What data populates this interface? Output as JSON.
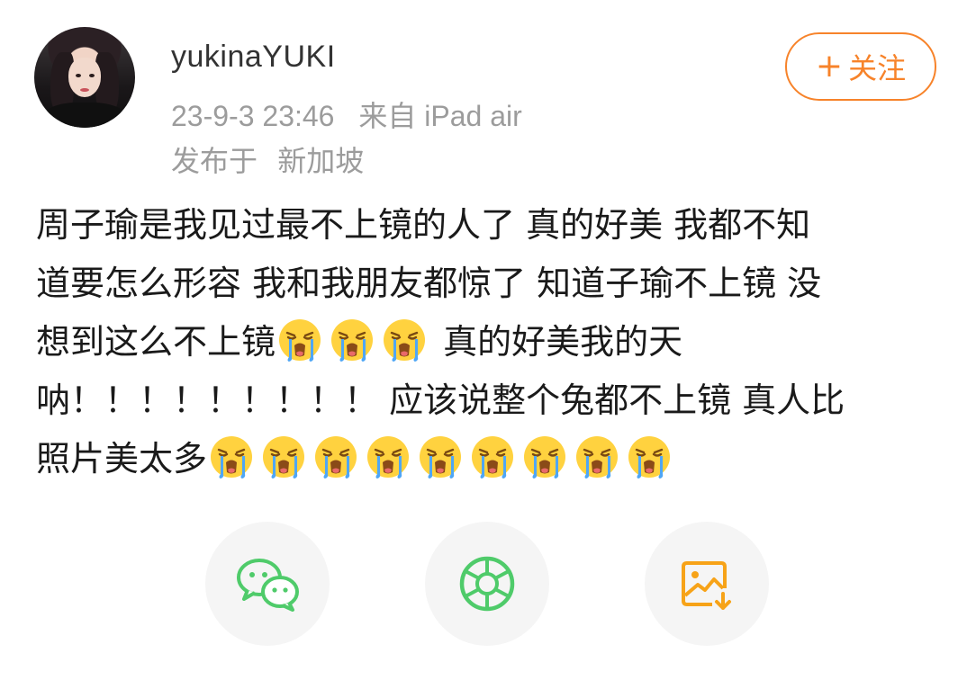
{
  "header": {
    "username": "yukinaYUKI",
    "timestamp": "23-9-3 23:46",
    "source": "来自 iPad air",
    "location_prefix": "发布于",
    "location": "新加坡",
    "follow_plus": "+",
    "follow_label": "关注"
  },
  "post": {
    "line1": "周子瑜是我见过最不上镜的人了 真的好美 我都不知",
    "line2": "道要怎么形容 我和我朋友都惊了 知道子瑜不上镜 没",
    "line3_a": "想到这么不上镜",
    "line3_b": "真的好美我的天",
    "line4": "呐！！！！！！！！！ 应该说整个兔都不上镜 真人比",
    "line5": "照片美太多",
    "emoji_name": "crying-emoji",
    "line3_emoji_count": 3,
    "line5_emoji_count": 9
  },
  "share": {
    "items": [
      {
        "icon": "wechat-icon"
      },
      {
        "icon": "moments-icon"
      },
      {
        "icon": "save-image-icon"
      }
    ]
  },
  "colors": {
    "accent": "#f7832a",
    "username": "#333333",
    "meta": "#9c9c9c",
    "text": "#1a1a1a",
    "wechat_green": "#4fcb6a",
    "save_orange": "#f7a318"
  }
}
